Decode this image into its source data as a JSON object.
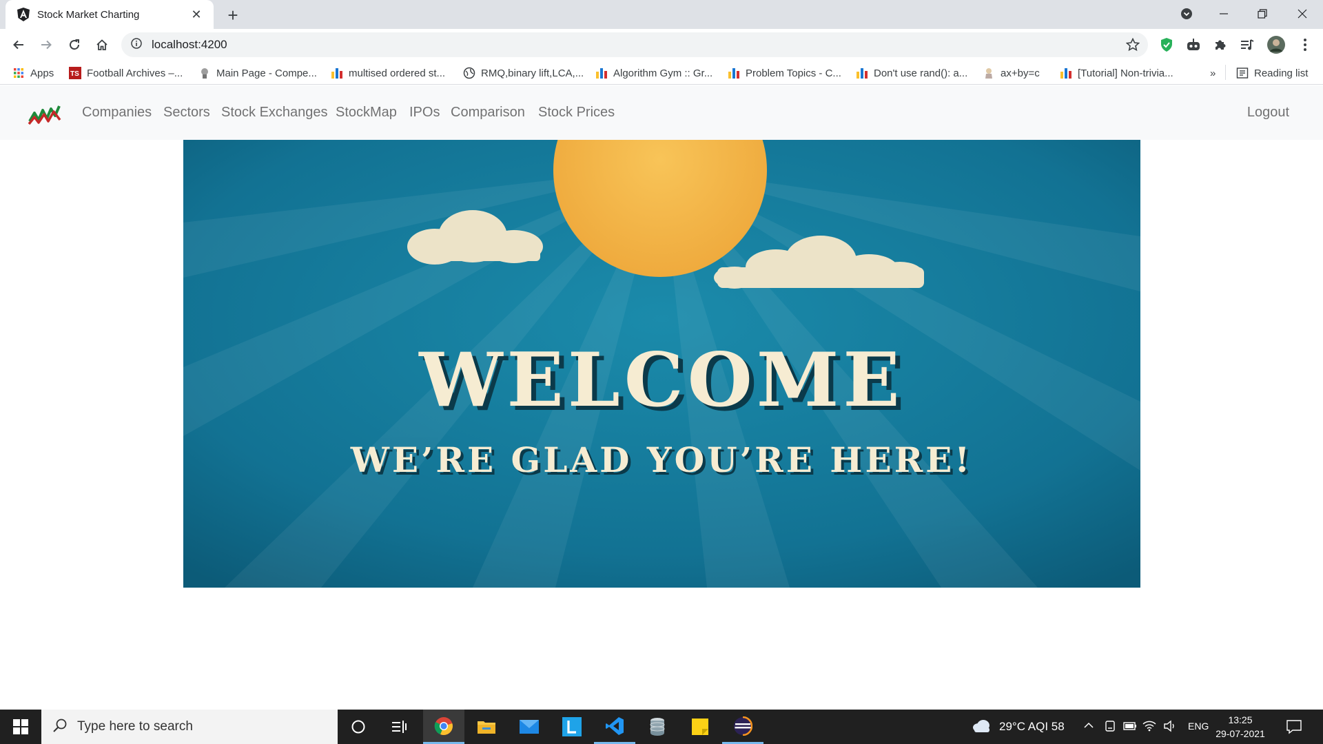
{
  "browser": {
    "tab_title": "Stock Market Charting",
    "url": "localhost:4200",
    "bookmarks": [
      {
        "label": "Apps",
        "icon": "apps-grid-icon"
      },
      {
        "label": "Football Archives –...",
        "icon": "ts-logo-icon"
      },
      {
        "label": "Main Page - Compe...",
        "icon": "wiki-icon"
      },
      {
        "label": "multised ordered st...",
        "icon": "codeforces-icon"
      },
      {
        "label": "RMQ,binary lift,LCA,...",
        "icon": "globe-icon"
      },
      {
        "label": "Algorithm Gym :: Gr...",
        "icon": "codeforces-icon"
      },
      {
        "label": "Problem Topics - C...",
        "icon": "codeforces-icon"
      },
      {
        "label": "Don't use rand(): a...",
        "icon": "codeforces-icon"
      },
      {
        "label": "ax+by=c",
        "icon": "cp-algorithms-icon"
      },
      {
        "label": "[Tutorial] Non-trivia...",
        "icon": "codeforces-icon"
      }
    ],
    "bookmarks_overflow": "»",
    "reading_list": "Reading list"
  },
  "navbar": {
    "links": [
      "Companies",
      "Sectors",
      "Stock Exchanges",
      "StockMap",
      "IPOs",
      "Comparison",
      "Stock Prices"
    ],
    "logout": "Logout"
  },
  "banner": {
    "headline": "WELCOME",
    "subline": "WE’RE GLAD YOU’RE HERE!",
    "colors": {
      "sky": "#137b9a",
      "sun": "#f3b445",
      "text": "#f6ecd2",
      "shadow": "#0b3a4a"
    }
  },
  "taskbar": {
    "search_placeholder": "Type here to search",
    "weather": "29°C  AQI 58",
    "language": "ENG",
    "time": "13:25",
    "date": "29-07-2021"
  }
}
